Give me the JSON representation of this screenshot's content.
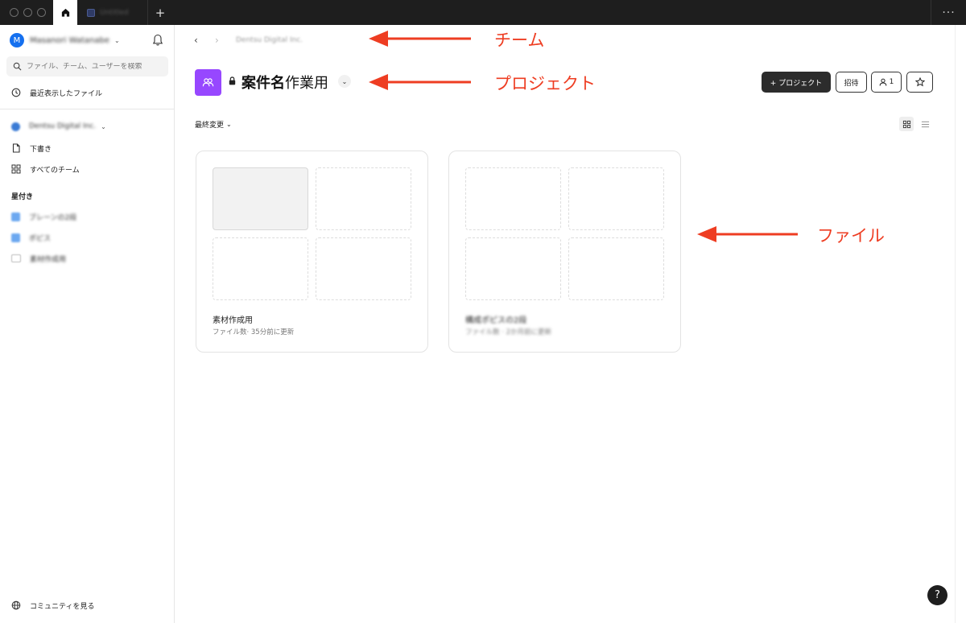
{
  "titlebar": {
    "file_tab_label": "Untitled",
    "add_tab_label": "+",
    "more_label": "···"
  },
  "sidebar": {
    "user": {
      "initial": "M",
      "name": "Masanori Watanabe"
    },
    "search_placeholder": "ファイル、チーム、ユーザーを検索",
    "recent_label": "最近表示したファイル",
    "team_name": "Dentsu Digital Inc.",
    "drafts_label": "下書き",
    "all_teams_label": "すべてのチーム",
    "starred_section_label": "星付き",
    "starred": [
      {
        "label": "ブレーンの2段"
      },
      {
        "label": "ポピス"
      },
      {
        "label": "素材作成用"
      }
    ],
    "community_label": "コミュニティを見る"
  },
  "main": {
    "breadcrumb_team": "Dentsu Digital Inc.",
    "project_title_bold": "案件名",
    "project_title_rest": "作業用",
    "new_project_label": "+ プロジェクト",
    "invite_label": "招待",
    "member_count": "1",
    "sort_label": "最終変更",
    "cards": [
      {
        "title": "素材作成用",
        "meta": "ファイル数· 35分前に更新"
      },
      {
        "title": "構成ポピスの2段",
        "meta": "ファイル数 · 2か月前に更新"
      }
    ]
  },
  "annotations": {
    "team": "チーム",
    "project": "プロジェクト",
    "file": "ファイル",
    "color": "#ee3d22"
  },
  "help_label": "?"
}
